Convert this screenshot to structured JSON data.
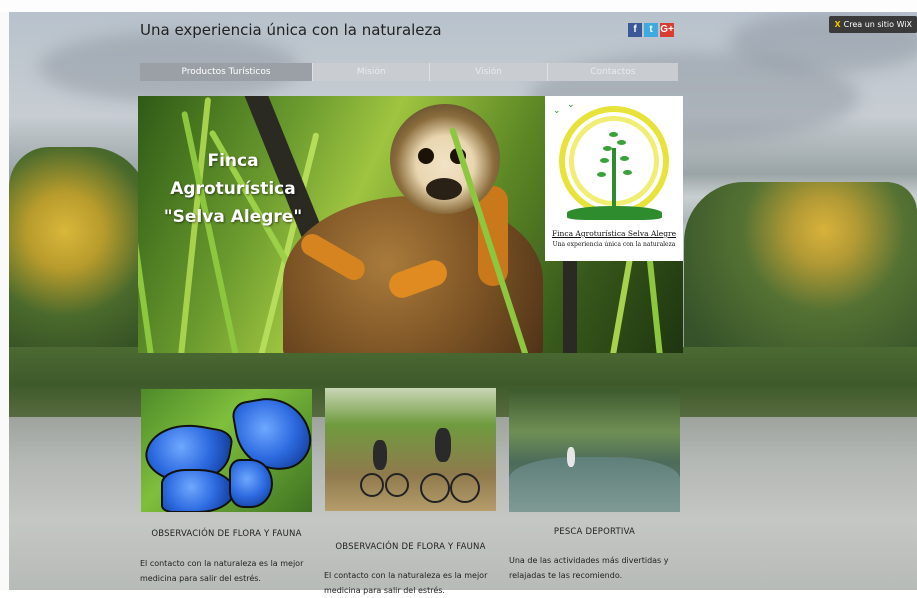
{
  "site": {
    "title": "Una experiencia única con la naturaleza",
    "wix_badge": "Crea un sitio WiX"
  },
  "social": [
    {
      "name": "facebook-icon",
      "glyph": "f"
    },
    {
      "name": "twitter-icon",
      "glyph": "t"
    },
    {
      "name": "google-plus-icon",
      "glyph": "G+"
    }
  ],
  "nav": {
    "items": [
      {
        "label": "Productos Turísticos",
        "active": true
      },
      {
        "label": "Misión",
        "active": false
      },
      {
        "label": "Visión",
        "active": false
      },
      {
        "label": "Contactos",
        "active": false
      }
    ]
  },
  "hero": {
    "line1": "Finca Agroturística",
    "line2": "\"Selva Alegre\""
  },
  "logo": {
    "name": "Finca Agroturística Selva Alegre",
    "tagline": "Una experiencia única con la naturaleza"
  },
  "cards": [
    {
      "title": "OBSERVACIÓN DE FLORA Y FAUNA",
      "text_line1": "El contacto con la naturaleza es la mejor",
      "text_line2": "medicina para salir del estrés."
    },
    {
      "title": "OBSERVACIÓN DE FLORA Y FAUNA",
      "text_line1": "El contacto con la naturaleza es la mejor",
      "text_line2": "medicina para salir del estrés."
    },
    {
      "title": "PESCA DEPORTIVA",
      "text_line1": "Una de las actividades más divertidas y",
      "text_line2": "relajadas te las recomiendo."
    }
  ],
  "colors": {
    "facebook": "#3b5998",
    "twitter": "#3fa9e0",
    "google_plus": "#d73d32",
    "nav_active": "#9aa0a6",
    "nav_inactive": "#c9cdd1",
    "logo_green": "#2e8b2e",
    "logo_yellow": "#e7e33a"
  }
}
